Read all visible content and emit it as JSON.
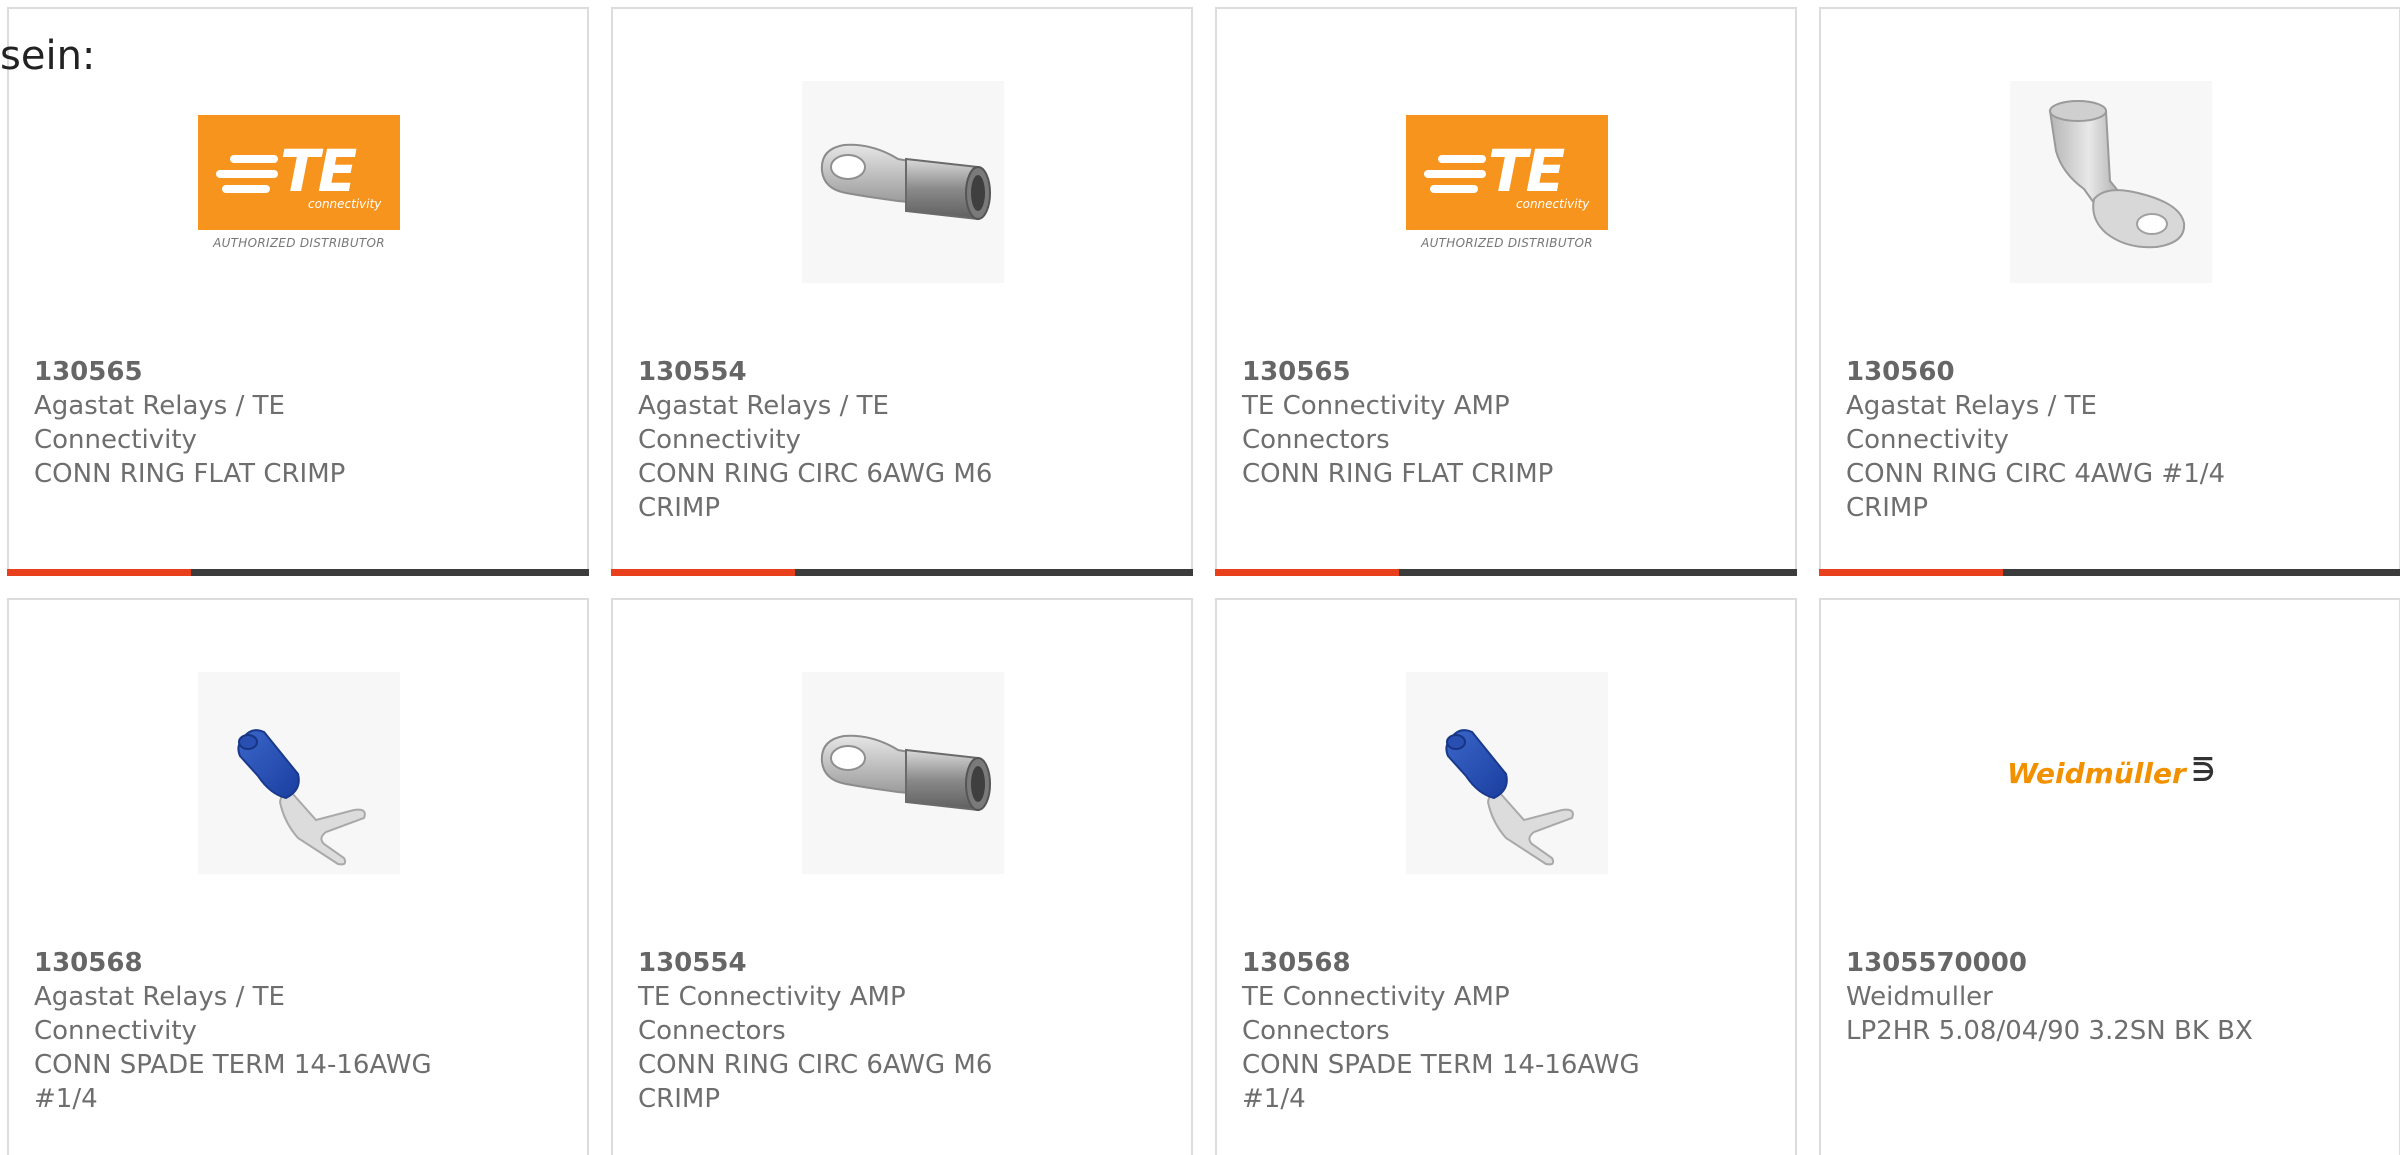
{
  "intro_text": "sein:",
  "colors": {
    "accent": "#e8401c",
    "bar": "#3c3c3c",
    "te_orange": "#f7941d",
    "weidmuller_orange": "#f29100"
  },
  "logos": {
    "te": {
      "letters": "TE",
      "sub": "connectivity",
      "distributor": "AUTHORIZED DISTRIBUTOR"
    },
    "weidmuller": {
      "name": "Weidmüller",
      "mark": "⋽"
    }
  },
  "cards": [
    {
      "image": "te-logo",
      "part_number": "130565",
      "manufacturer": "Agastat Relays / TE Connectivity",
      "description": "CONN RING FLAT CRIMP"
    },
    {
      "image": "ring-terminal-horizontal",
      "part_number": "130554",
      "manufacturer": "Agastat Relays / TE Connectivity",
      "description": "CONN RING CIRC 6AWG M6 CRIMP"
    },
    {
      "image": "te-logo",
      "part_number": "130565",
      "manufacturer": "TE Connectivity AMP Connectors",
      "description": "CONN RING FLAT CRIMP"
    },
    {
      "image": "ring-terminal-diagonal",
      "part_number": "130560",
      "manufacturer": "Agastat Relays / TE Connectivity",
      "description": "CONN RING CIRC 4AWG #1/4 CRIMP"
    },
    {
      "image": "spade-terminal-blue",
      "part_number": "130568",
      "manufacturer": "Agastat Relays / TE Connectivity",
      "description": "CONN SPADE TERM 14-16AWG #1/4"
    },
    {
      "image": "ring-terminal-horizontal",
      "part_number": "130554",
      "manufacturer": "TE Connectivity AMP Connectors",
      "description": "CONN RING CIRC 6AWG M6 CRIMP"
    },
    {
      "image": "spade-terminal-blue",
      "part_number": "130568",
      "manufacturer": "TE Connectivity AMP Connectors",
      "description": "CONN SPADE TERM 14-16AWG #1/4"
    },
    {
      "image": "weidmuller-logo",
      "part_number": "1305570000",
      "manufacturer": "Weidmuller",
      "description": "LP2HR 5.08/04/90 3.2SN BK BX"
    }
  ]
}
